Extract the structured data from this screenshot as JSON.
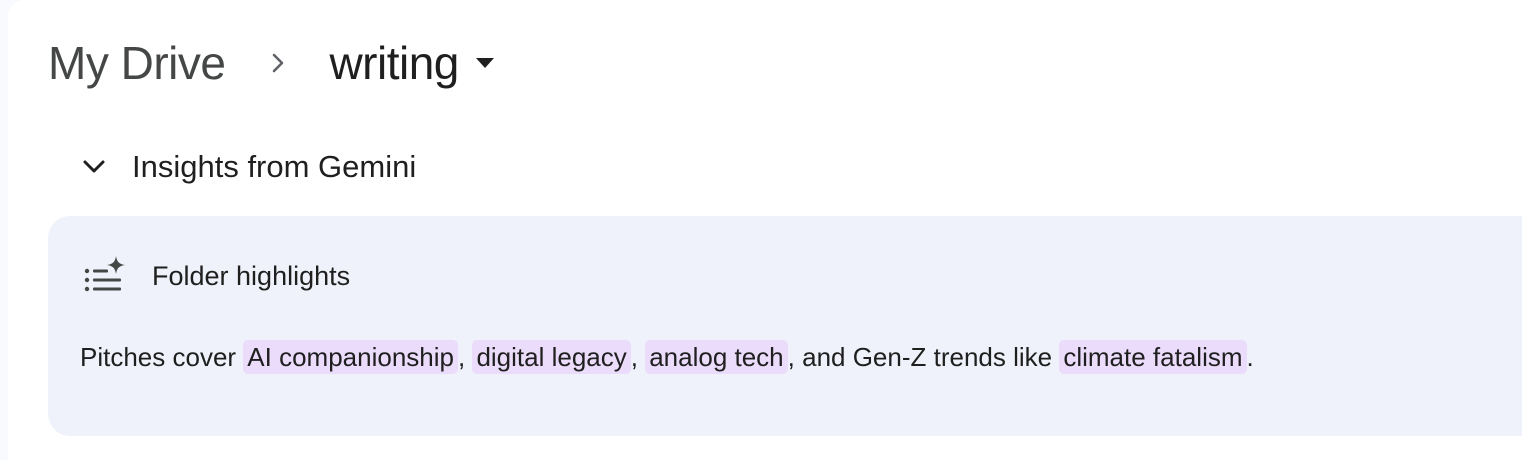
{
  "breadcrumb": {
    "root": "My Drive",
    "separator_icon": "chevron-right-icon",
    "current": "writing",
    "current_menu_icon": "caret-down-icon"
  },
  "insights": {
    "toggle_icon": "chevron-down-icon",
    "label": "Insights from Gemini"
  },
  "highlights_card": {
    "icon": "sparkle-list-icon",
    "title": "Folder highlights",
    "summary": {
      "prefix": "Pitches cover ",
      "topic_1": "AI companionship",
      "sep_1": ", ",
      "topic_2": "digital legacy",
      "sep_2": ", ",
      "topic_3": "analog tech",
      "middle": ", and Gen-Z trends like ",
      "topic_4": "climate fatalism",
      "suffix": "."
    },
    "colors": {
      "card_background": "#eff2fa",
      "chip_background": "#ebdcfb"
    }
  }
}
